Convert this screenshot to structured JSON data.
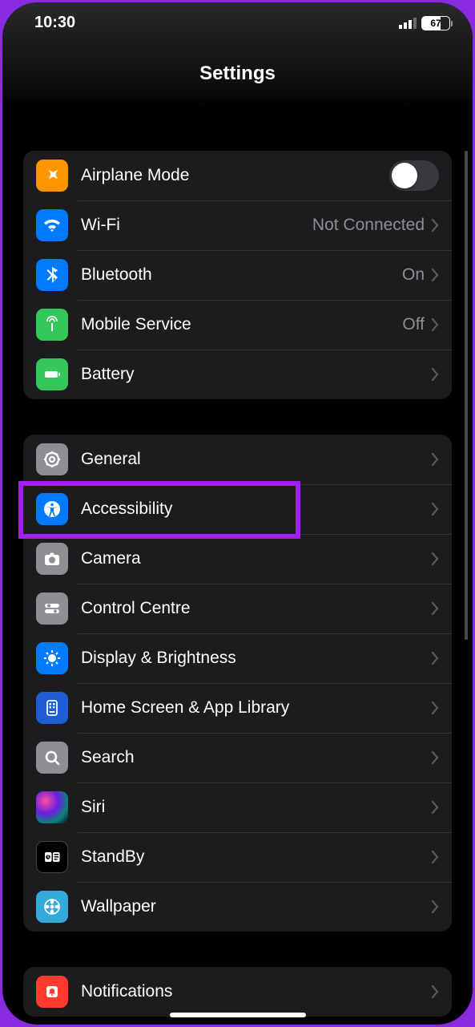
{
  "status": {
    "time": "10:30",
    "battery": "67"
  },
  "header": {
    "title": "Settings"
  },
  "groups": [
    {
      "rows": [
        {
          "id": "airplane",
          "label": "Airplane Mode",
          "kind": "toggle",
          "icon_bg": "#ff9500"
        },
        {
          "id": "wifi",
          "label": "Wi-Fi",
          "value": "Not Connected",
          "kind": "link",
          "icon_bg": "#007aff"
        },
        {
          "id": "bluetooth",
          "label": "Bluetooth",
          "value": "On",
          "kind": "link",
          "icon_bg": "#007aff"
        },
        {
          "id": "mobile",
          "label": "Mobile Service",
          "value": "Off",
          "kind": "link",
          "icon_bg": "#34c759"
        },
        {
          "id": "battery",
          "label": "Battery",
          "kind": "link",
          "icon_bg": "#34c759"
        }
      ]
    },
    {
      "rows": [
        {
          "id": "general",
          "label": "General",
          "kind": "link",
          "icon_bg": "#8e8e93"
        },
        {
          "id": "accessibility",
          "label": "Accessibility",
          "kind": "link",
          "icon_bg": "#007aff",
          "highlighted": true
        },
        {
          "id": "camera",
          "label": "Camera",
          "kind": "link",
          "icon_bg": "#8e8e93"
        },
        {
          "id": "control-centre",
          "label": "Control Centre",
          "kind": "link",
          "icon_bg": "#8e8e93"
        },
        {
          "id": "display",
          "label": "Display & Brightness",
          "kind": "link",
          "icon_bg": "#007aff"
        },
        {
          "id": "home-screen",
          "label": "Home Screen & App Library",
          "kind": "link",
          "icon_bg": "#1f5dd6"
        },
        {
          "id": "search",
          "label": "Search",
          "kind": "link",
          "icon_bg": "#8e8e93"
        },
        {
          "id": "siri",
          "label": "Siri",
          "kind": "link",
          "icon_bg": "siri"
        },
        {
          "id": "standby",
          "label": "StandBy",
          "kind": "link",
          "icon_bg": "#000000"
        },
        {
          "id": "wallpaper",
          "label": "Wallpaper",
          "kind": "link",
          "icon_bg": "#34aadc"
        }
      ]
    },
    {
      "rows": [
        {
          "id": "notifications",
          "label": "Notifications",
          "kind": "link",
          "icon_bg": "#ff3b30"
        }
      ]
    }
  ]
}
